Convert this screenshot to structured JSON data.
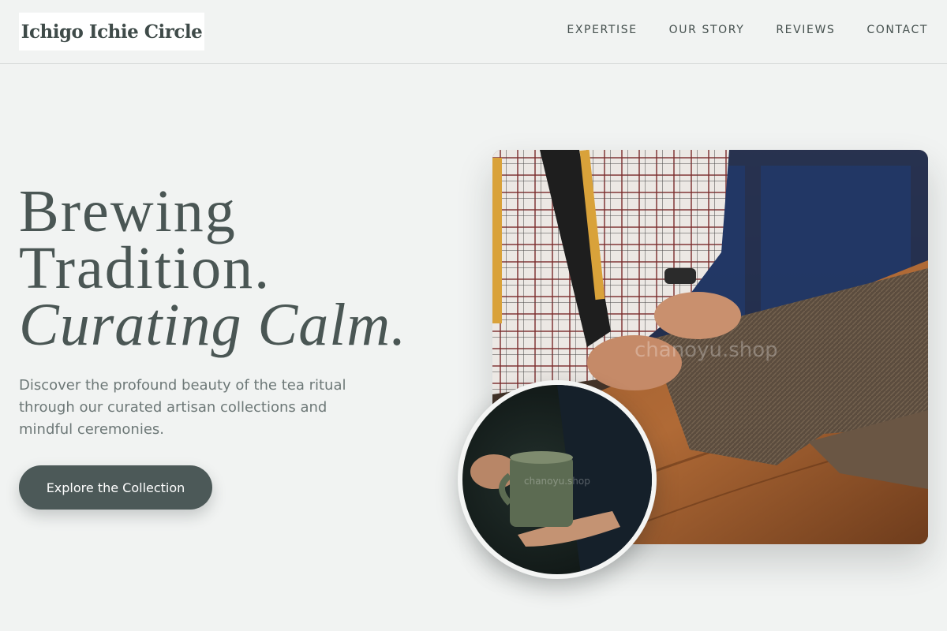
{
  "header": {
    "logo": "Ichigo Ichie Circle",
    "nav": [
      "EXPERTISE",
      "OUR STORY",
      "REVIEWS",
      "CONTACT"
    ]
  },
  "hero": {
    "title_line1": "Brewing",
    "title_line2": "Tradition.",
    "title_line3": "Curating Calm.",
    "description": "Discover the profound beauty of the tea ritual through our curated artisan collections and mindful ceremonies.",
    "cta_label": "Explore the Collection"
  },
  "images": {
    "main_watermark": "chanoyu.shop",
    "circle_watermark": "chanoyu.shop"
  },
  "colors": {
    "background": "#f1f3f2",
    "text": "#46514f",
    "button": "#4c5958",
    "button_text": "#ffffff"
  }
}
